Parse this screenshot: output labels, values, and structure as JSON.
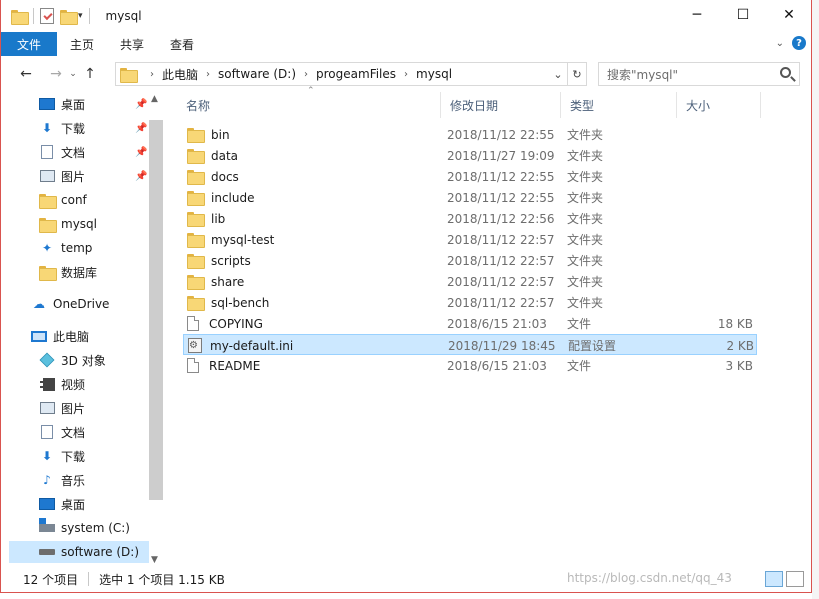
{
  "window": {
    "title": "mysql",
    "controls": {
      "minimize": "─",
      "maximize": "☐",
      "close": "✕"
    }
  },
  "ribbon": {
    "tabs": [
      "文件",
      "主页",
      "共享",
      "查看"
    ],
    "help": "?"
  },
  "address": {
    "crumbs": [
      "此电脑",
      "software (D:)",
      "progeamFiles",
      "mysql"
    ]
  },
  "search": {
    "placeholder": "搜索\"mysql\""
  },
  "nav": {
    "items": [
      {
        "label": "桌面",
        "icon": "desktop-icon",
        "pinned": true
      },
      {
        "label": "下载",
        "icon": "download-icon",
        "pinned": true
      },
      {
        "label": "文档",
        "icon": "documents-icon",
        "pinned": true
      },
      {
        "label": "图片",
        "icon": "pictures-icon",
        "pinned": true
      },
      {
        "label": "conf",
        "icon": "folder-icon",
        "pinned": false
      },
      {
        "label": "mysql",
        "icon": "folder-icon",
        "pinned": false
      },
      {
        "label": "temp",
        "icon": "star-icon",
        "pinned": false
      },
      {
        "label": "数据库",
        "icon": "folder-icon",
        "pinned": false
      },
      {
        "label": "OneDrive",
        "icon": "cloud-icon",
        "pinned": false
      },
      {
        "label": "此电脑",
        "icon": "computer-icon",
        "pinned": false
      },
      {
        "label": "3D 对象",
        "icon": "3d-objects-icon",
        "pinned": false
      },
      {
        "label": "视频",
        "icon": "videos-icon",
        "pinned": false
      },
      {
        "label": "图片",
        "icon": "pictures-icon",
        "pinned": false
      },
      {
        "label": "文档",
        "icon": "documents-icon",
        "pinned": false
      },
      {
        "label": "下载",
        "icon": "download-icon",
        "pinned": false
      },
      {
        "label": "音乐",
        "icon": "music-icon",
        "pinned": false
      },
      {
        "label": "桌面",
        "icon": "desktop-icon",
        "pinned": false
      },
      {
        "label": "system (C:)",
        "icon": "system-drive-icon",
        "pinned": false
      },
      {
        "label": "software (D:)",
        "icon": "drive-icon",
        "pinned": false
      }
    ]
  },
  "columns": {
    "name": "名称",
    "date": "修改日期",
    "type": "类型",
    "size": "大小"
  },
  "files": [
    {
      "name": "bin",
      "date": "2018/11/12 22:55",
      "type": "文件夹",
      "size": "",
      "kind": "folder"
    },
    {
      "name": "data",
      "date": "2018/11/27 19:09",
      "type": "文件夹",
      "size": "",
      "kind": "folder"
    },
    {
      "name": "docs",
      "date": "2018/11/12 22:55",
      "type": "文件夹",
      "size": "",
      "kind": "folder"
    },
    {
      "name": "include",
      "date": "2018/11/12 22:55",
      "type": "文件夹",
      "size": "",
      "kind": "folder"
    },
    {
      "name": "lib",
      "date": "2018/11/12 22:56",
      "type": "文件夹",
      "size": "",
      "kind": "folder"
    },
    {
      "name": "mysql-test",
      "date": "2018/11/12 22:57",
      "type": "文件夹",
      "size": "",
      "kind": "folder"
    },
    {
      "name": "scripts",
      "date": "2018/11/12 22:57",
      "type": "文件夹",
      "size": "",
      "kind": "folder"
    },
    {
      "name": "share",
      "date": "2018/11/12 22:57",
      "type": "文件夹",
      "size": "",
      "kind": "folder"
    },
    {
      "name": "sql-bench",
      "date": "2018/11/12 22:57",
      "type": "文件夹",
      "size": "",
      "kind": "folder"
    },
    {
      "name": "COPYING",
      "date": "2018/6/15 21:03",
      "type": "文件",
      "size": "18 KB",
      "kind": "file"
    },
    {
      "name": "my-default.ini",
      "date": "2018/11/29 18:45",
      "type": "配置设置",
      "size": "2 KB",
      "kind": "config",
      "selected": true
    },
    {
      "name": "README",
      "date": "2018/6/15 21:03",
      "type": "文件",
      "size": "3 KB",
      "kind": "file"
    }
  ],
  "status": {
    "count": "12 个项目",
    "selection": "选中 1 个项目  1.15 KB"
  },
  "watermark": "https://blog.csdn.net/qq_43"
}
